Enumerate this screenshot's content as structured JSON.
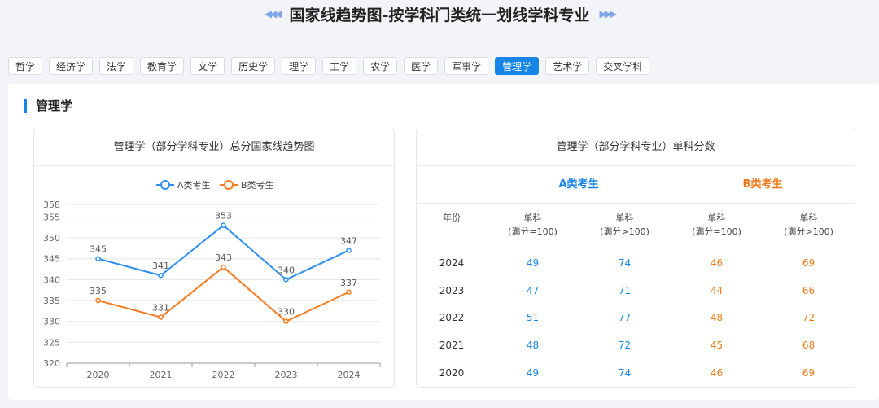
{
  "header": {
    "title": "国家线趋势图-按学科门类统一划线学科专业",
    "left_arrows": "◀◀◀",
    "right_arrows": "▶▶▶"
  },
  "tabs": [
    {
      "label": "哲学",
      "active": false
    },
    {
      "label": "经济学",
      "active": false
    },
    {
      "label": "法学",
      "active": false
    },
    {
      "label": "教育学",
      "active": false
    },
    {
      "label": "文学",
      "active": false
    },
    {
      "label": "历史学",
      "active": false
    },
    {
      "label": "理学",
      "active": false
    },
    {
      "label": "工学",
      "active": false
    },
    {
      "label": "农学",
      "active": false
    },
    {
      "label": "医学",
      "active": false
    },
    {
      "label": "军事学",
      "active": false
    },
    {
      "label": "管理学",
      "active": true
    },
    {
      "label": "艺术学",
      "active": false
    },
    {
      "label": "交叉学科",
      "active": false
    }
  ],
  "section": {
    "title": "管理学"
  },
  "chart_card": {
    "title": "管理学（部分学科专业）总分国家线趋势图"
  },
  "chart_data": {
    "type": "line",
    "categories": [
      "2020",
      "2021",
      "2022",
      "2023",
      "2024"
    ],
    "series": [
      {
        "name": "A类考生",
        "values": [
          345,
          341,
          353,
          340,
          347
        ],
        "color": "#2a8ff0"
      },
      {
        "name": "B类考生",
        "values": [
          335,
          331,
          343,
          330,
          337
        ],
        "color": "#f47b20"
      }
    ],
    "ylim": [
      320,
      358
    ],
    "yticks": [
      320,
      325,
      330,
      335,
      340,
      345,
      350,
      355,
      358
    ],
    "legend_position": "top-center",
    "grid": true,
    "xlabel": "",
    "ylabel": "",
    "title": "管理学（部分学科专业）总分国家线趋势图"
  },
  "table_card": {
    "title": "管理学（部分学科专业）单科分数",
    "groups": [
      {
        "label": "A类考生",
        "color": "#1685e5"
      },
      {
        "label": "B类考生",
        "color": "#f07a1a"
      }
    ],
    "year_header": "年份",
    "columns": [
      {
        "line1": "单科",
        "line2": "(满分=100)"
      },
      {
        "line1": "单科",
        "line2": "(满分>100)"
      },
      {
        "line1": "单科",
        "line2": "(满分=100)"
      },
      {
        "line1": "单科",
        "line2": "(满分>100)"
      }
    ],
    "rows": [
      {
        "year": "2024",
        "values": [
          "49",
          "74",
          "46",
          "69"
        ]
      },
      {
        "year": "2023",
        "values": [
          "47",
          "71",
          "44",
          "66"
        ]
      },
      {
        "year": "2022",
        "values": [
          "51",
          "77",
          "48",
          "72"
        ]
      },
      {
        "year": "2021",
        "values": [
          "48",
          "72",
          "45",
          "68"
        ]
      },
      {
        "year": "2020",
        "values": [
          "49",
          "74",
          "46",
          "69"
        ]
      }
    ]
  }
}
